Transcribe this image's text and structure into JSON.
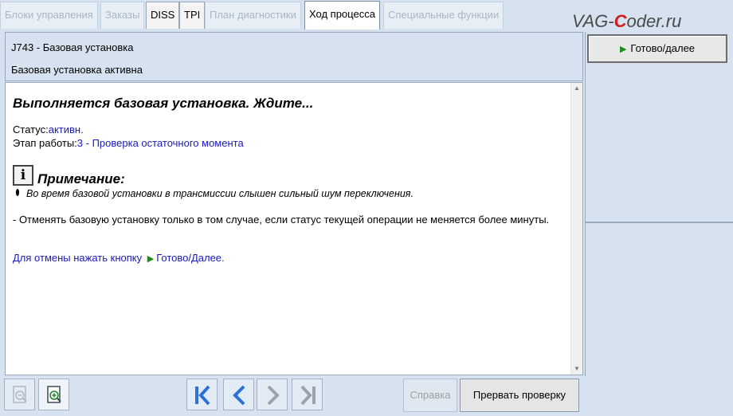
{
  "tabs": [
    {
      "label": "Блоки управления",
      "state": "disabled"
    },
    {
      "label": "Заказы",
      "state": "disabled"
    },
    {
      "label": "DISS",
      "state": "enabled"
    },
    {
      "label": "TPI",
      "state": "enabled"
    },
    {
      "label": "План диагностики",
      "state": "disabled"
    },
    {
      "label": "Ход процесса",
      "state": "active"
    },
    {
      "label": "Специальные функции",
      "state": "disabled"
    }
  ],
  "watermark": {
    "part1": "VAG-",
    "part2": "C",
    "part3": "oder.ru"
  },
  "header": {
    "module": "J743 - Базовая установка",
    "state": "Базовая установка активна"
  },
  "content": {
    "title": "Выполняется базовая установка. Ждите...",
    "status_label": "Статус:",
    "status_value": "активн.",
    "stage_label": "Этап работы:",
    "stage_value": "3 - Проверка остаточного момента",
    "info_icon_glyph": "i",
    "note_title": "Примечание:",
    "note_item": "Во время базовой установки в трансмиссии слышен сильный шум переключения.",
    "cancel_note": "- Отменять базовую установку только в том случае, если статус текущей операции не меняется более минуты.",
    "hint_text": "Для отмены нажать кнопку",
    "hint_button": "Готово/Далее."
  },
  "right_panel": {
    "ready_button": "Готово/далее"
  },
  "bottom": {
    "help_button": "Справка",
    "abort_button": "Прервать проверку"
  },
  "colors": {
    "panel_bg": "#d6e2ef",
    "link_blue": "#1a1ab8",
    "play_green": "#1c8c1c",
    "nav_blue": "#2f6fd6"
  }
}
